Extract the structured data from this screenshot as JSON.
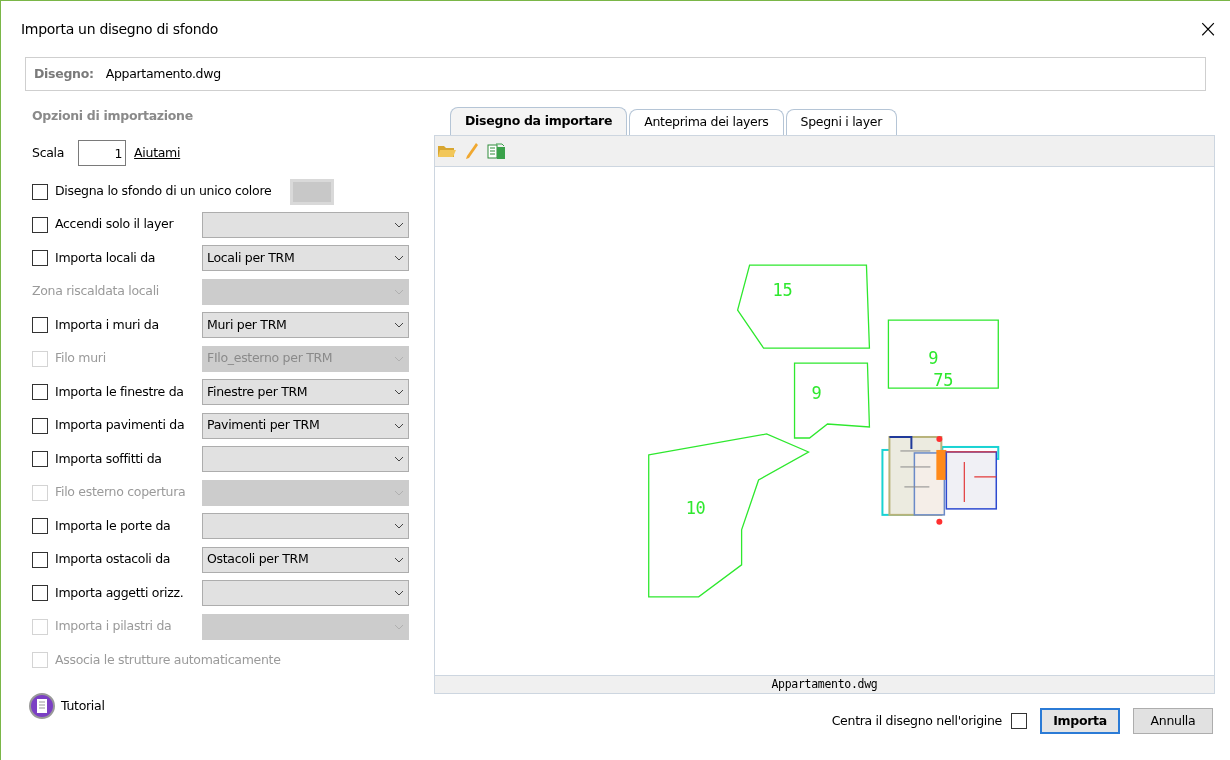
{
  "window": {
    "title": "Importa un disegno di sfondo",
    "close": "×"
  },
  "file": {
    "label": "Disegno:",
    "value": "Appartamento.dwg"
  },
  "options": {
    "title": "Opzioni di importazione",
    "scale": {
      "label": "Scala",
      "value": "1",
      "help_link": "Aiutami"
    },
    "rows": [
      {
        "kind": "checkbox-color",
        "label": "Disegna lo sfondo di un unico colore",
        "checked": false,
        "disabled": false
      },
      {
        "kind": "checkbox-select",
        "label": "Accendi solo il layer",
        "checked": false,
        "disabled": false,
        "select": {
          "disabled": false
        }
      },
      {
        "kind": "checkbox-select",
        "label": "Importa locali da",
        "checked": false,
        "disabled": false,
        "select": {
          "value": "Locali per TRM",
          "disabled": false
        }
      },
      {
        "kind": "label-select",
        "label": "Zona riscaldata locali",
        "disabled": true,
        "select": {
          "disabled": true
        }
      },
      {
        "kind": "checkbox-select",
        "label": "Importa i muri da",
        "checked": false,
        "disabled": false,
        "select": {
          "value": "Muri per TRM",
          "disabled": false
        }
      },
      {
        "kind": "checkbox-select",
        "label": "Filo muri",
        "checked": false,
        "disabled": true,
        "select": {
          "value": "FIlo_esterno per TRM",
          "disabled": true
        }
      },
      {
        "kind": "checkbox-select",
        "label": "Importa le finestre da",
        "checked": false,
        "disabled": false,
        "select": {
          "value": "Finestre per TRM",
          "disabled": false
        }
      },
      {
        "kind": "checkbox-select",
        "label": "Importa pavimenti da",
        "checked": false,
        "disabled": false,
        "select": {
          "value": "Pavimenti per TRM",
          "disabled": false
        }
      },
      {
        "kind": "checkbox-select",
        "label": "Importa soffitti da",
        "checked": false,
        "disabled": false,
        "select": {
          "disabled": false
        }
      },
      {
        "kind": "checkbox-select",
        "label": "Filo esterno copertura",
        "checked": false,
        "disabled": true,
        "select": {
          "disabled": true
        }
      },
      {
        "kind": "checkbox-select",
        "label": "Importa le porte da",
        "checked": false,
        "disabled": false,
        "select": {
          "disabled": false
        }
      },
      {
        "kind": "checkbox-select",
        "label": "Importa ostacoli da",
        "checked": false,
        "disabled": false,
        "select": {
          "value": "Ostacoli per TRM",
          "disabled": false
        }
      },
      {
        "kind": "checkbox-select",
        "label": "Importa aggetti orizz.",
        "checked": false,
        "disabled": false,
        "select": {
          "disabled": false
        }
      },
      {
        "kind": "checkbox-select",
        "label": "Importa i pilastri da",
        "checked": false,
        "disabled": true,
        "select": {
          "disabled": true
        }
      },
      {
        "kind": "checkbox",
        "label": "Associa le strutture automaticamente",
        "checked": false,
        "disabled": true
      }
    ]
  },
  "tutorial": "Tutorial",
  "tabs": [
    {
      "label": "Disegno da importare",
      "selected": true
    },
    {
      "label": "Anteprima dei layers",
      "selected": false
    },
    {
      "label": "Spegni i layer",
      "selected": false
    }
  ],
  "drawing": {
    "labels": [
      "15",
      "9",
      "75",
      "9",
      "10"
    ],
    "file_name": "Appartamento.dwg"
  },
  "footer": {
    "center_label": "Centra il disegno nell'origine",
    "center_checked": false,
    "buttons": [
      {
        "label": "Importa",
        "default": true
      },
      {
        "label": "Annulla",
        "default": false
      }
    ]
  }
}
